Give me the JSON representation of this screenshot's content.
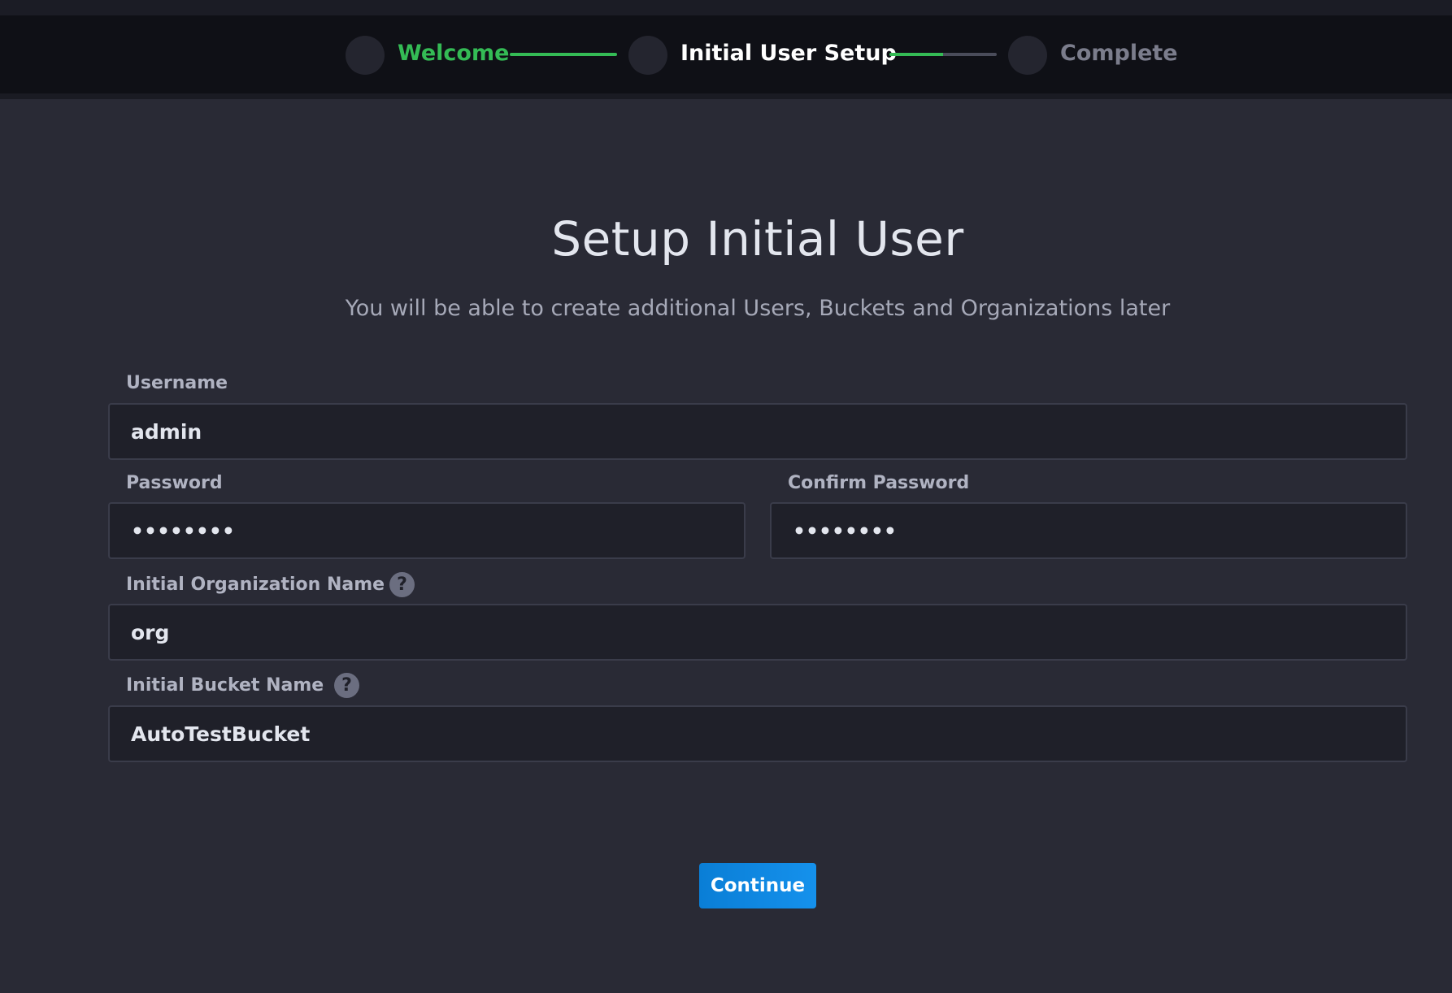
{
  "stepper": {
    "steps": [
      {
        "label": "Welcome",
        "state": "completed",
        "color": "#34bb55"
      },
      {
        "label": "Initial User Setup",
        "state": "current",
        "color": "#ffffff"
      },
      {
        "label": "Complete",
        "state": "upcoming",
        "color": "#7b7d8c"
      }
    ],
    "connectors": [
      {
        "progress": 1.0,
        "color": "#34bb55"
      },
      {
        "progress": 0.5,
        "color": "#34bb55"
      }
    ]
  },
  "page": {
    "title": "Setup Initial User",
    "subtitle": "You will be able to create additional Users, Buckets and Organizations later"
  },
  "form": {
    "username": {
      "label": "Username",
      "value": "admin"
    },
    "password": {
      "label": "Password",
      "value": "password"
    },
    "confirm_password": {
      "label": "Confirm Password",
      "value": "password"
    },
    "org_name": {
      "label": "Initial Organization Name",
      "value": "org",
      "help_icon": "question-circle"
    },
    "bucket_name": {
      "label": "Initial Bucket Name",
      "value": "AutoTestBucket",
      "help_icon": "question-circle"
    }
  },
  "actions": {
    "continue_label": "Continue",
    "accent_color": "#0b86df"
  }
}
